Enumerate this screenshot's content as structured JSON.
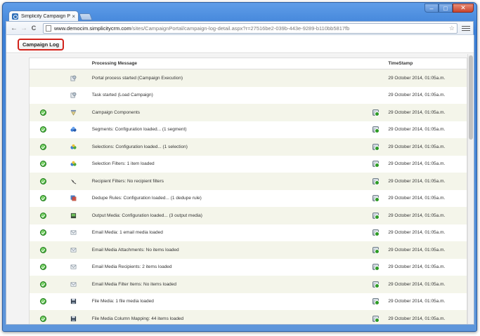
{
  "browser": {
    "tab_title": "Simplicity Campaign Port",
    "tab_close": "×",
    "url_host": "www.democim.simplicitycrm.com",
    "url_path": "/sites/CampaignPortal/campaign-log-detail.aspx?r=27516be2-039b-443e-9289-b110bb5817fb",
    "back": "←",
    "forward": "→",
    "reload": "C",
    "star": "☆",
    "min": "–",
    "max": "□",
    "close": "✕"
  },
  "page": {
    "campaign_log_button": "Campaign Log"
  },
  "table": {
    "headers": {
      "message": "Processing Message",
      "time": "TimeStamp"
    },
    "rows": [
      {
        "status": "",
        "type_icon": "process-icon",
        "message": "Portal process started (Campaign Execution)",
        "detail": false,
        "time": "29 October 2014, 01:05a.m."
      },
      {
        "status": "",
        "type_icon": "process-icon",
        "message": "Task started (Load Campaign)",
        "detail": false,
        "time": "29 October 2014, 01:05a.m."
      },
      {
        "status": "ok",
        "type_icon": "components-icon",
        "message": "Campaign Components",
        "detail": true,
        "time": "29 October 2014, 01:05a.m."
      },
      {
        "status": "ok",
        "type_icon": "segments-icon",
        "message": "Segments: Configuration loaded... (1 segment)",
        "detail": true,
        "time": "29 October 2014, 01:05a.m."
      },
      {
        "status": "ok",
        "type_icon": "selections-icon",
        "message": "Selections: Configuration loaded... (1 selection)",
        "detail": true,
        "time": "29 October 2014, 01:05a.m."
      },
      {
        "status": "ok",
        "type_icon": "selections-icon",
        "message": "Selection Filters: 1 item loaded",
        "detail": true,
        "time": "29 October 2014, 01:05a.m."
      },
      {
        "status": "ok",
        "type_icon": "filter-icon",
        "message": "Recipient Filters: No recipient filters",
        "detail": true,
        "time": "29 October 2014, 01:05a.m."
      },
      {
        "status": "ok",
        "type_icon": "dedupe-icon",
        "message": "Dedupe Rules: Configuration loaded... (1 dedupe rule)",
        "detail": true,
        "time": "29 October 2014, 01:05a.m."
      },
      {
        "status": "ok",
        "type_icon": "output-media-icon",
        "message": "Output Media: Configuration loaded... (3 output media)",
        "detail": true,
        "time": "29 October 2014, 01:05a.m."
      },
      {
        "status": "ok",
        "type_icon": "email-icon",
        "message": "Email Media: 1 email media loaded",
        "detail": true,
        "time": "29 October 2014, 01:05a.m."
      },
      {
        "status": "ok",
        "type_icon": "email-icon",
        "message": "Email Media Attachments: No items loaded",
        "detail": true,
        "time": "29 October 2014, 01:05a.m."
      },
      {
        "status": "ok",
        "type_icon": "email-icon",
        "message": "Email Media Recipients: 2 items loaded",
        "detail": true,
        "time": "29 October 2014, 01:05a.m."
      },
      {
        "status": "ok",
        "type_icon": "email-icon",
        "message": "Email Media Filter Items: No items loaded",
        "detail": true,
        "time": "29 October 2014, 01:05a.m."
      },
      {
        "status": "ok",
        "type_icon": "file-icon",
        "message": "File Media: 1 file media loaded",
        "detail": true,
        "time": "29 October 2014, 01:05a.m."
      },
      {
        "status": "ok",
        "type_icon": "file-icon",
        "message": "File Media Column Mapping: 44 items loaded",
        "detail": true,
        "time": "29 October 2014, 01:05a.m."
      }
    ]
  },
  "colors": {
    "accent_red": "#d2231b",
    "row_alt": "#f4f5ea",
    "ok_green": "#2d9b25"
  }
}
